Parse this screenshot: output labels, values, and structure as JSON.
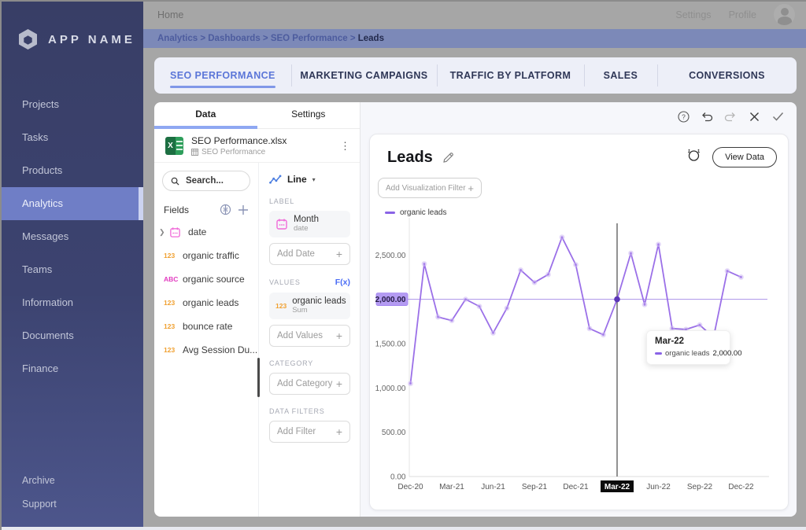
{
  "app": {
    "name": "APP NAME"
  },
  "topbar": {
    "home": "Home",
    "settings": "Settings",
    "profile": "Profile"
  },
  "breadcrumb": {
    "crumbs": [
      "Analytics",
      "Dashboards",
      "SEO Performance"
    ],
    "current": "Leads",
    "separator": " > "
  },
  "sidebar": {
    "items": [
      "Projects",
      "Tasks",
      "Products",
      "Analytics",
      "Messages",
      "Teams",
      "Information",
      "Documents",
      "Finance"
    ],
    "active": "Analytics",
    "footer_items": [
      "Archive",
      "Support"
    ]
  },
  "dashboard_tabs": {
    "items": [
      "SEO PERFORMANCE",
      "MARKETING CAMPAIGNS",
      "TRAFFIC BY PLATFORM",
      "SALES",
      "CONVERSIONS"
    ],
    "active": "SEO PERFORMANCE"
  },
  "data_panel": {
    "tab_data": "Data",
    "tab_settings": "Settings",
    "file": {
      "name": "SEO Performance.xlsx",
      "sheet": "SEO Performance"
    },
    "search_placeholder": "Search...",
    "fields_label": "Fields",
    "fields": [
      {
        "name": "date",
        "type": "date",
        "expandable": true
      },
      {
        "name": "organic traffic",
        "type": "number"
      },
      {
        "name": "organic source",
        "type": "text"
      },
      {
        "name": "organic leads",
        "type": "number"
      },
      {
        "name": "bounce rate",
        "type": "number"
      },
      {
        "name": "Avg Session Du...",
        "type": "number"
      }
    ]
  },
  "config_panel": {
    "chart_type": "Line",
    "label_section": "LABEL",
    "label_chip": {
      "title": "Month",
      "subtitle": "date"
    },
    "add_date": "Add Date",
    "values_section": "VALUES",
    "fx": "F(x)",
    "value_chip": {
      "title": "organic leads",
      "subtitle": "Sum"
    },
    "add_values": "Add Values",
    "category_section": "CATEGORY",
    "add_category": "Add Category",
    "filters_section": "DATA FILTERS",
    "add_filter": "Add Filter"
  },
  "chart_panel": {
    "title": "Leads",
    "view_data_label": "View Data",
    "viz_filter_placeholder": "Add Visualization Filter",
    "legend": "organic leads",
    "tooltip": {
      "title": "Mar-22",
      "series": "organic leads",
      "value": "2,000.00"
    }
  },
  "chart_data": {
    "type": "line",
    "title": "Leads",
    "x": [
      "Dec-20",
      "Jan-21",
      "Feb-21",
      "Mar-21",
      "Apr-21",
      "May-21",
      "Jun-21",
      "Jul-21",
      "Aug-21",
      "Sep-21",
      "Oct-21",
      "Nov-21",
      "Dec-21",
      "Jan-22",
      "Feb-22",
      "Mar-22",
      "Apr-22",
      "May-22",
      "Jun-22",
      "Jul-22",
      "Aug-22",
      "Sep-22",
      "Oct-22",
      "Nov-22",
      "Dec-22"
    ],
    "series": [
      {
        "name": "organic leads",
        "color": "#9b70e8",
        "values": [
          1050,
          2400,
          1800,
          1760,
          2000,
          1920,
          1620,
          1900,
          2330,
          2190,
          2280,
          2700,
          2390,
          1670,
          1600,
          2000,
          2520,
          1940,
          2620,
          1670,
          1660,
          1710,
          1570,
          2320,
          2250
        ]
      }
    ],
    "x_tick_labels": [
      "Dec-20",
      "Mar-21",
      "Jun-21",
      "Sep-21",
      "Dec-21",
      "Mar-22",
      "Jun-22",
      "Sep-22",
      "Dec-22"
    ],
    "y_tick_values": [
      0,
      500,
      1000,
      1500,
      2000,
      2500
    ],
    "y_tick_labels": [
      "0.00",
      "500.00",
      "1,000.00",
      "1,500.00",
      "2,000.00",
      "2,500.00"
    ],
    "ylim": [
      0,
      2900
    ],
    "grid": false,
    "legend_position": "top-left",
    "highlight": {
      "month": "Mar-22",
      "value": 2000,
      "reference_value": 2000,
      "axis_label_bg": "#b49bf2",
      "crosshair_color": "#4a4a4a"
    }
  }
}
